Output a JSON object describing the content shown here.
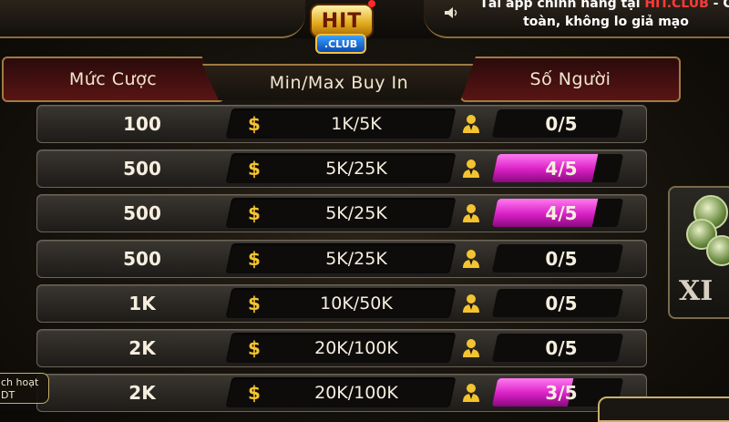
{
  "header": {
    "promo_line1_prefix": "Tải app chính hãng tại ",
    "promo_brand": "HIT.CLUB",
    "promo_line1_suffix": " - C",
    "promo_line2": "toàn, không lo giả mạo",
    "logo_text": "HIT",
    "logo_sub": ".CLUB"
  },
  "columns": {
    "bet": "Mức Cược",
    "buyin": "Min/Max Buy In",
    "players": "Số Người"
  },
  "rows": [
    {
      "bet": "100",
      "currency": "$",
      "buyin": "1K/5K",
      "players": "0/5",
      "fill": 0
    },
    {
      "bet": "500",
      "currency": "$",
      "buyin": "5K/25K",
      "players": "4/5",
      "fill": 0.8
    },
    {
      "bet": "500",
      "currency": "$",
      "buyin": "5K/25K",
      "players": "4/5",
      "fill": 0.8
    },
    {
      "bet": "500",
      "currency": "$",
      "buyin": "5K/25K",
      "players": "0/5",
      "fill": 0
    },
    {
      "bet": "1K",
      "currency": "$",
      "buyin": "10K/50K",
      "players": "0/5",
      "fill": 0
    },
    {
      "bet": "2K",
      "currency": "$",
      "buyin": "20K/100K",
      "players": "0/5",
      "fill": 0
    },
    {
      "bet": "2K",
      "currency": "$",
      "buyin": "20K/100K",
      "players": "3/5",
      "fill": 0.6
    }
  ],
  "side": {
    "game_text": "XI",
    "left_tag_line1": "ch hoạt",
    "left_tag_line2": "DT"
  },
  "colors": {
    "accent_gold": "#f4c430",
    "fill_magenta": "#d81fc4",
    "brand_red": "#ff3a3a"
  },
  "icons": [
    "sound-icon",
    "dollar-icon",
    "person-icon"
  ]
}
